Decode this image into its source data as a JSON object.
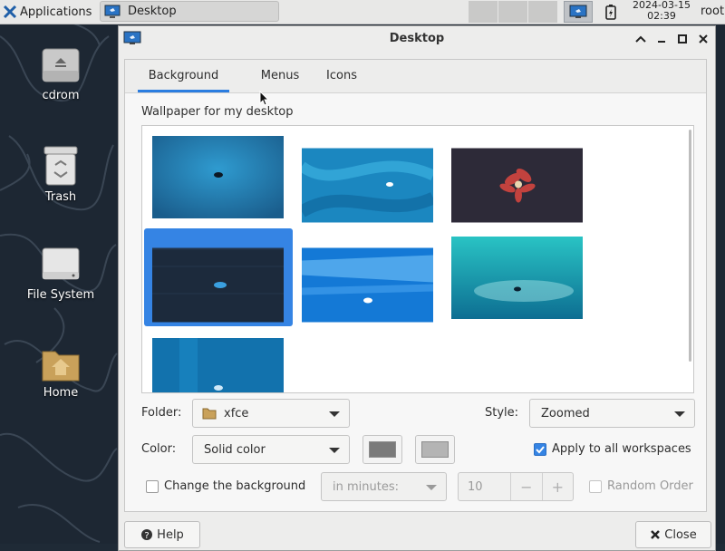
{
  "panel": {
    "apps_label": "Applications",
    "task_label": "Desktop",
    "date": "2024-03-15",
    "time": "02:39",
    "user": "root"
  },
  "desktop_icons": [
    {
      "label": "cdrom",
      "icon": "optical-drive-icon"
    },
    {
      "label": "Trash",
      "icon": "trash-icon"
    },
    {
      "label": "File System",
      "icon": "hard-drive-icon"
    },
    {
      "label": "Home",
      "icon": "home-folder-icon"
    }
  ],
  "dialog": {
    "title": "Desktop",
    "tabs": [
      "Background",
      "Menus",
      "Icons"
    ],
    "active_tab": "Background",
    "wallpaper_label": "Wallpaper for my desktop",
    "folder_label": "Folder:",
    "folder_value": "xfce",
    "style_label": "Style:",
    "style_value": "Zoomed",
    "color_label": "Color:",
    "color_value": "Solid color",
    "apply_all_label": "Apply to all workspaces",
    "apply_all_checked": true,
    "change_bg_label": "Change the background",
    "change_bg_checked": false,
    "interval_value": "in minutes:",
    "interval_number": "10",
    "random_label": "Random Order",
    "random_checked": false,
    "help_label": "Help",
    "close_label": "Close"
  },
  "colors": {
    "accent": "#3584e4",
    "swatch1": "#7a7a7a",
    "swatch2": "#b4b4b4"
  }
}
